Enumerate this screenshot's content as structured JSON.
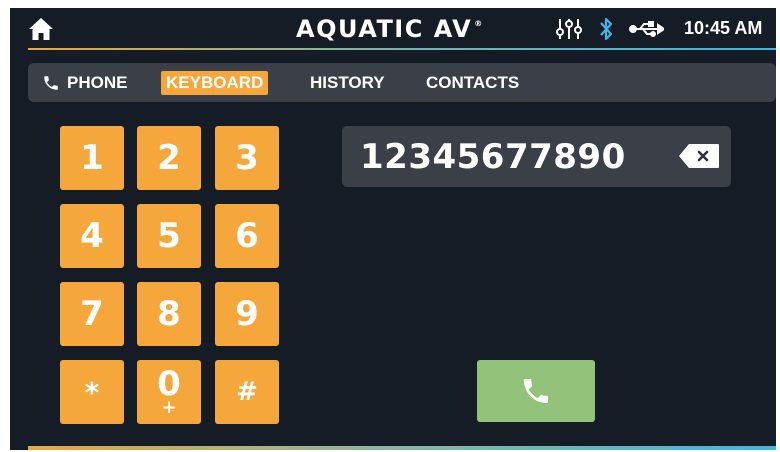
{
  "statusbar": {
    "brand": "AQUATIC AV",
    "brand_mark": "®",
    "time": "10:45 AM",
    "icons": [
      "home-icon",
      "equalizer-icon",
      "bluetooth-icon",
      "usb-icon"
    ]
  },
  "tabs": [
    {
      "label": "PHONE",
      "icon": "phone-icon",
      "selected": false
    },
    {
      "label": "KEYBOARD",
      "selected": true
    },
    {
      "label": "HISTORY",
      "selected": false
    },
    {
      "label": "CONTACTS",
      "selected": false
    }
  ],
  "keypad": {
    "keys": [
      "1",
      "2",
      "3",
      "4",
      "5",
      "6",
      "7",
      "8",
      "9",
      "*",
      "0",
      "#"
    ],
    "zero_sub": "+"
  },
  "dialer": {
    "number": "12345677890",
    "backspace_icon": "backspace-icon",
    "call_icon": "phone-call-icon"
  },
  "colors": {
    "background": "#151c26",
    "panel": "#3a3f48",
    "accent": "#f5a73b",
    "call": "#93c27a",
    "line_start": "#e6a93f",
    "line_end": "#3fb7dd"
  }
}
